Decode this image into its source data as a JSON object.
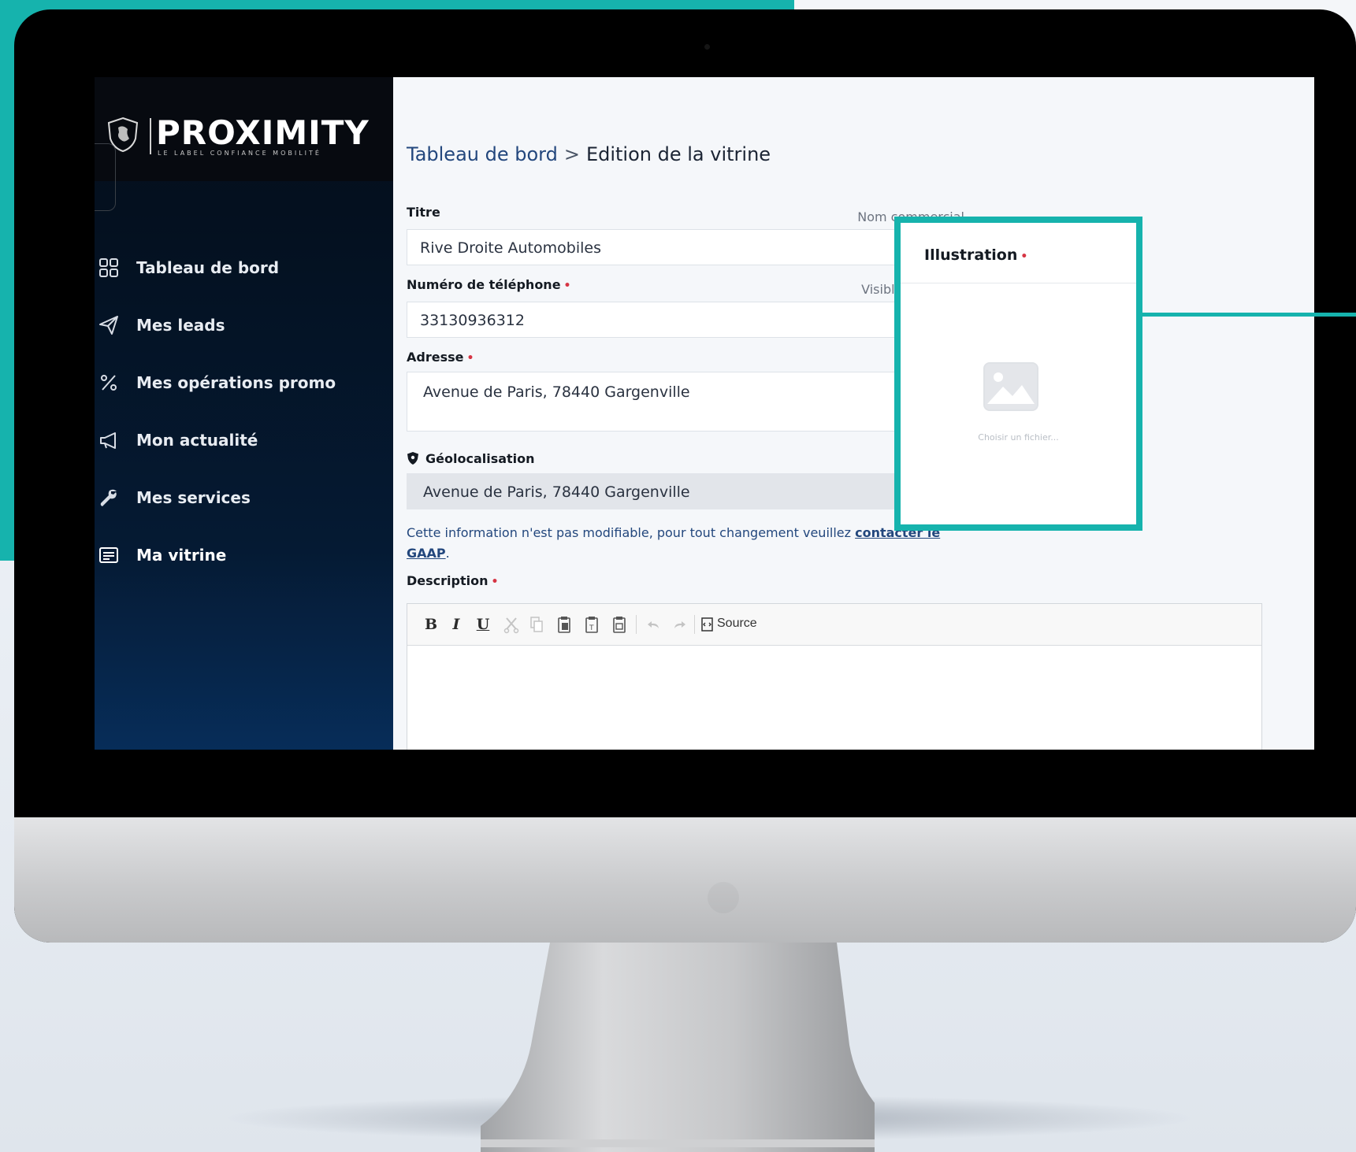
{
  "brand": {
    "logo_text": "PROXIMITY",
    "tagline": "LE LABEL CONFIANCE MOBILITÉ"
  },
  "sidebar": {
    "items": [
      {
        "label": "Tableau de bord",
        "icon": "grid-icon"
      },
      {
        "label": "Mes leads",
        "icon": "send-icon"
      },
      {
        "label": "Mes opérations promo",
        "icon": "percent-icon"
      },
      {
        "label": "Mon actualité",
        "icon": "megaphone-icon"
      },
      {
        "label": "Mes services",
        "icon": "wrench-icon"
      },
      {
        "label": "Ma vitrine",
        "icon": "list-card-icon"
      }
    ]
  },
  "breadcrumb": {
    "parent": "Tableau de bord",
    "separator": ">",
    "current": "Edition de la vitrine"
  },
  "form": {
    "title": {
      "label": "Titre",
      "hint": "Nom commercial",
      "value": "Rive Droite Automobiles"
    },
    "phone": {
      "label": "Numéro de téléphone",
      "hint": "Visible du public",
      "value": "33130936312"
    },
    "address": {
      "label": "Adresse",
      "value": "Avenue de Paris, 78440 Gargenville"
    },
    "geo": {
      "label": "Géolocalisation",
      "value": "Avenue de Paris, 78440 Gargenville",
      "info_text": "Cette information n'est pas modifiable, pour tout changement veuillez ",
      "info_link": "contacter le GAAP",
      "info_end": "."
    },
    "description": {
      "label": "Description",
      "toolbar": {
        "bold": "B",
        "italic": "I",
        "underline": "U",
        "source": "Source"
      }
    },
    "required_mark": "•"
  },
  "illustration": {
    "label": "Illustration",
    "choose_file": "Choisir un fichier..."
  },
  "colors": {
    "accent": "#16b3ad",
    "link": "#23477d",
    "required": "#d63544",
    "sidebar_bg": "#061428"
  }
}
